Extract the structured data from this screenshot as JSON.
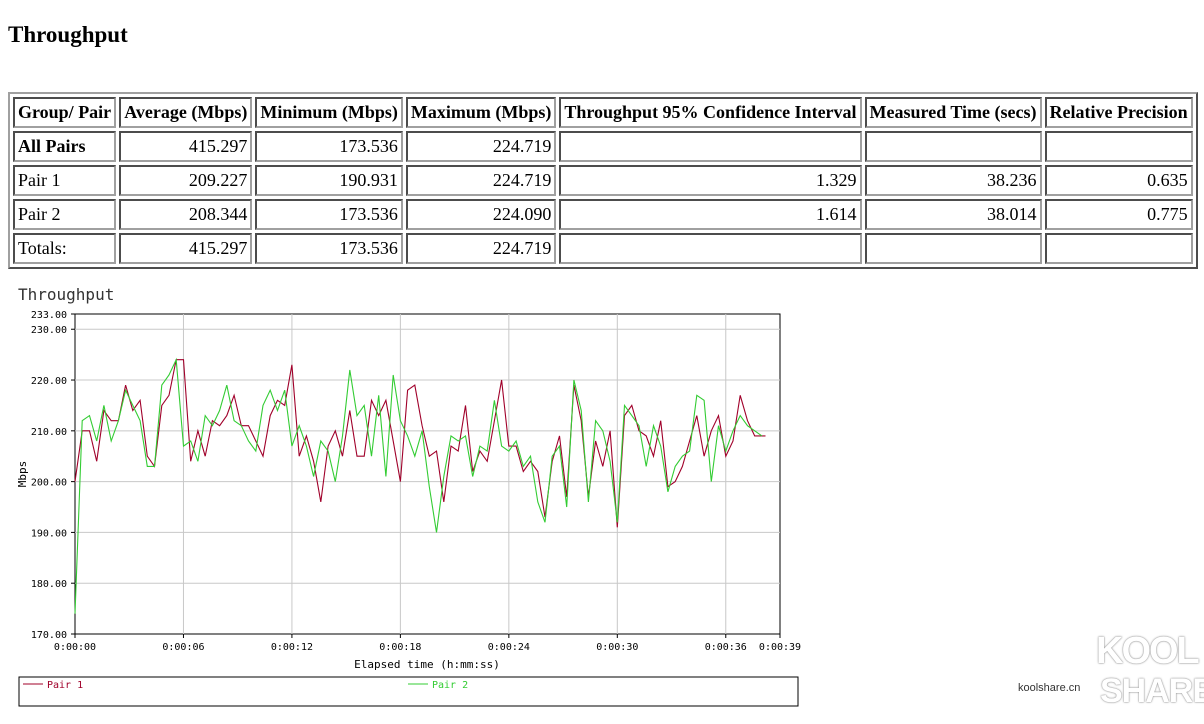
{
  "page_title": "Throughput",
  "table": {
    "headers": [
      "Group/ Pair",
      "Average (Mbps)",
      "Minimum (Mbps)",
      "Maximum (Mbps)",
      "Throughput 95% Confidence Interval",
      "Measured Time (secs)",
      "Relative Precision"
    ],
    "rows": [
      {
        "group": "All Pairs",
        "avg": "415.297",
        "min": "173.536",
        "max": "224.719",
        "ci": "",
        "time": "",
        "precision": ""
      },
      {
        "group": "Pair 1",
        "avg": "209.227",
        "min": "190.931",
        "max": "224.719",
        "ci": "1.329",
        "time": "38.236",
        "precision": "0.635"
      },
      {
        "group": "Pair 2",
        "avg": "208.344",
        "min": "173.536",
        "max": "224.090",
        "ci": "1.614",
        "time": "38.014",
        "precision": "0.775"
      },
      {
        "group": "Totals:",
        "avg": "415.297",
        "min": "173.536",
        "max": "224.719",
        "ci": "",
        "time": "",
        "precision": ""
      }
    ]
  },
  "watermark": {
    "top": "KOOL",
    "middle": "koolshare.cn",
    "bottom": "SHARE"
  },
  "chart_data": {
    "type": "line",
    "title": "Throughput",
    "xlabel": "Elapsed time (h:mm:ss)",
    "ylabel": "Mbps",
    "xlim": [
      0,
      39
    ],
    "ylim": [
      170,
      233
    ],
    "y_ticks": [
      "170.00",
      "180.00",
      "190.00",
      "200.00",
      "210.00",
      "220.00",
      "230.00",
      "233.00"
    ],
    "y_tick_values": [
      170,
      180,
      190,
      200,
      210,
      220,
      230,
      233
    ],
    "x_ticks": [
      "0:00:00",
      "0:00:06",
      "0:00:12",
      "0:00:18",
      "0:00:24",
      "0:00:30",
      "0:00:36",
      "0:00:39"
    ],
    "x_tick_values": [
      0,
      6,
      12,
      18,
      24,
      30,
      36,
      39
    ],
    "grid": true,
    "legend": "bottom",
    "series": [
      {
        "name": "Pair 1",
        "color": "#a0002a",
        "x": [
          0,
          0.4,
          0.8,
          1.2,
          1.6,
          2.0,
          2.4,
          2.8,
          3.2,
          3.6,
          4.0,
          4.4,
          4.8,
          5.2,
          5.6,
          6.0,
          6.4,
          6.8,
          7.2,
          7.6,
          8.0,
          8.4,
          8.8,
          9.2,
          9.6,
          10.0,
          10.4,
          10.8,
          11.2,
          11.6,
          12.0,
          12.4,
          12.8,
          13.2,
          13.6,
          14.0,
          14.4,
          14.8,
          15.2,
          15.6,
          16.0,
          16.4,
          16.8,
          17.2,
          17.6,
          18.0,
          18.4,
          18.8,
          19.2,
          19.6,
          20.0,
          20.4,
          20.8,
          21.2,
          21.6,
          22.0,
          22.4,
          22.8,
          23.2,
          23.6,
          24.0,
          24.4,
          24.8,
          25.2,
          25.6,
          26.0,
          26.4,
          26.8,
          27.2,
          27.6,
          28.0,
          28.4,
          28.8,
          29.2,
          29.6,
          30.0,
          30.4,
          30.8,
          31.2,
          31.6,
          32.0,
          32.4,
          32.8,
          33.2,
          33.6,
          34.0,
          34.4,
          34.8,
          35.2,
          35.6,
          36.0,
          36.4,
          36.8,
          37.2,
          37.6,
          38.0,
          38.2
        ],
        "y": [
          200,
          210,
          210,
          204,
          214,
          212,
          212,
          219,
          214,
          216,
          205,
          203,
          215,
          217,
          224,
          224,
          204,
          210,
          205,
          212,
          211,
          213,
          217,
          211,
          211,
          208,
          205,
          213,
          216,
          215,
          223,
          205,
          209,
          204,
          196,
          207,
          210,
          205,
          214,
          205,
          205,
          216,
          213,
          216,
          208,
          200,
          218,
          219,
          211,
          205,
          206,
          196,
          207,
          206,
          215,
          202,
          206,
          204,
          212,
          220,
          207,
          207,
          202,
          204,
          202,
          193,
          204,
          209,
          197,
          219,
          212,
          197,
          208,
          203,
          210,
          191,
          213,
          215,
          210,
          209,
          205,
          212,
          199,
          200,
          203,
          208,
          213,
          205,
          210,
          213,
          205,
          208,
          217,
          212,
          209,
          209,
          209
        ]
      },
      {
        "name": "Pair 2",
        "color": "#33cc33",
        "x": [
          0,
          0.4,
          0.8,
          1.2,
          1.6,
          2.0,
          2.4,
          2.8,
          3.2,
          3.6,
          4.0,
          4.4,
          4.8,
          5.2,
          5.6,
          6.0,
          6.4,
          6.8,
          7.2,
          7.6,
          8.0,
          8.4,
          8.8,
          9.2,
          9.6,
          10.0,
          10.4,
          10.8,
          11.2,
          11.6,
          12.0,
          12.4,
          12.8,
          13.2,
          13.6,
          14.0,
          14.4,
          14.8,
          15.2,
          15.6,
          16.0,
          16.4,
          16.8,
          17.2,
          17.6,
          18.0,
          18.4,
          18.8,
          19.2,
          19.6,
          20.0,
          20.4,
          20.8,
          21.2,
          21.6,
          22.0,
          22.4,
          22.8,
          23.2,
          23.6,
          24.0,
          24.4,
          24.8,
          25.2,
          25.6,
          26.0,
          26.4,
          26.8,
          27.2,
          27.6,
          28.0,
          28.4,
          28.8,
          29.2,
          29.6,
          30.0,
          30.4,
          30.8,
          31.2,
          31.6,
          32.0,
          32.4,
          32.8,
          33.2,
          33.6,
          34.0,
          34.4,
          34.8,
          35.2,
          35.6,
          36.0,
          36.4,
          36.8,
          37.2,
          37.6,
          38.0
        ],
        "y": [
          174,
          212,
          213,
          208,
          215,
          208,
          212,
          218,
          215,
          212,
          203,
          203,
          219,
          221,
          224,
          207,
          208,
          204,
          213,
          211,
          214,
          219,
          212,
          211,
          208,
          206,
          215,
          218,
          214,
          218,
          207,
          211,
          207,
          201,
          208,
          206,
          200,
          209,
          222,
          213,
          215,
          205,
          217,
          201,
          221,
          212,
          209,
          205,
          210,
          199,
          190,
          201,
          209,
          208,
          209,
          201,
          207,
          206,
          216,
          207,
          206,
          208,
          203,
          205,
          196,
          192,
          205,
          207,
          195,
          220,
          214,
          196,
          212,
          210,
          204,
          192,
          215,
          213,
          211,
          203,
          211,
          207,
          198,
          203,
          205,
          206,
          217,
          216,
          200,
          211,
          206,
          210,
          213,
          211,
          210,
          209
        ]
      }
    ]
  }
}
